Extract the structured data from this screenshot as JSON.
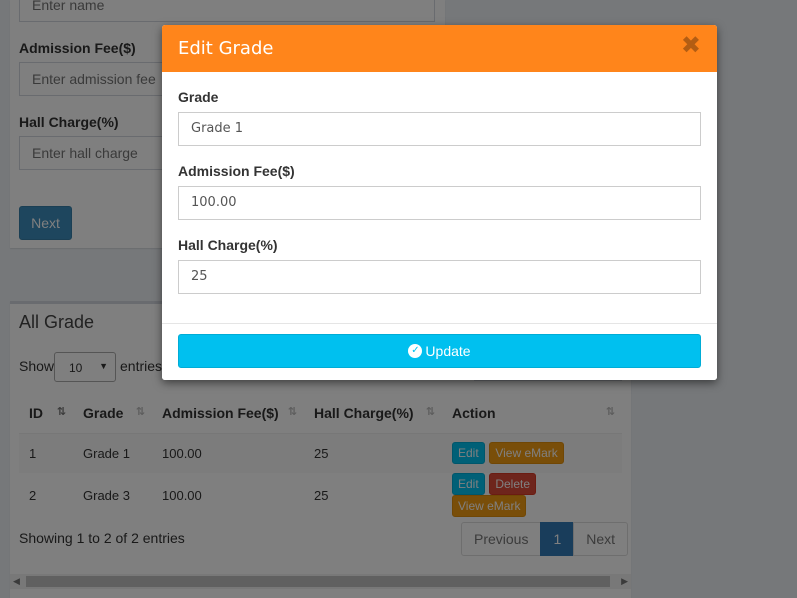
{
  "form": {
    "name_placeholder": "Enter name",
    "fee_label": "Admission Fee($)",
    "fee_placeholder": "Enter admission fee",
    "hall_label": "Hall Charge(%)",
    "hall_placeholder": "Enter hall charge",
    "next_label": "Next"
  },
  "table_box": {
    "title": "All Grade",
    "show_label": "Show",
    "page_length": "10",
    "entries_label": "entries",
    "columns": [
      "ID",
      "Grade",
      "Admission Fee($)",
      "Hall Charge(%)",
      "Action"
    ],
    "rows": [
      {
        "id": "1",
        "grade": "Grade 1",
        "fee": "100.00",
        "hall": "25",
        "actions": [
          "Edit",
          "View eMark"
        ]
      },
      {
        "id": "2",
        "grade": "Grade 3",
        "fee": "100.00",
        "hall": "25",
        "actions": [
          "Edit",
          "Delete",
          "View eMark"
        ]
      }
    ],
    "info": "Showing 1 to 2 of 2 entries",
    "pagination": {
      "previous": "Previous",
      "current": "1",
      "next": "Next"
    }
  },
  "modal": {
    "title": "Edit Grade",
    "close_glyph": "✖",
    "grade_label": "Grade",
    "grade_value": "Grade 1",
    "fee_label": "Admission Fee($)",
    "fee_value": "100.00",
    "hall_label": "Hall Charge(%)",
    "hall_value": "25",
    "update_label": "Update",
    "update_icon": "check-circle-icon"
  },
  "colors": {
    "modal_header": "#ff851b",
    "update_button": "#00c0ef",
    "primary": "#3c8dbc",
    "danger": "#dd4b39",
    "warning": "#f39c12"
  }
}
